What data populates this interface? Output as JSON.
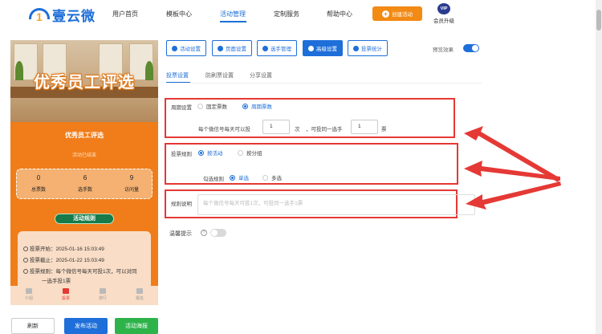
{
  "header": {
    "logo_text": "壹云微",
    "nav": [
      "用户首页",
      "模板中心",
      "活动管理",
      "定制服务",
      "帮助中心"
    ],
    "active_nav": "活动管理",
    "create_button": "创建活动",
    "vip_badge": "VIP",
    "vip_label": "会员升级"
  },
  "preview": {
    "banner_title": "优秀员工评选",
    "title": "优秀员工评选",
    "status": "活动已结束",
    "stats": [
      {
        "value": "0",
        "label": "总票数"
      },
      {
        "value": "6",
        "label": "选手数"
      },
      {
        "value": "9",
        "label": "访问量"
      }
    ],
    "rules_button": "活动规则",
    "info": {
      "start": "投票开始：2025-01-16 15:03:49",
      "end": "投票截止：2025-01-22 15:03:49",
      "rule_line1": "投票规则：每个微信号每天可投1次，可以对同",
      "rule_line2": "一选手投1票"
    },
    "tabbar": [
      "介绍",
      "投票",
      "排行",
      "报名"
    ],
    "active_tab": "投票"
  },
  "footer_buttons": {
    "refresh": "刷新",
    "publish": "发布活动",
    "poster": "活动海报"
  },
  "settings": {
    "tabs": [
      "活动设置",
      "页面设置",
      "选手管理",
      "高级设置",
      "投票统计"
    ],
    "active_tab": "高级设置",
    "preview_label": "预览效果",
    "preview_on": true,
    "inner_tabs": [
      "投票设置",
      "防刷票设置",
      "分享设置"
    ],
    "active_inner_tab": "投票设置",
    "cycle": {
      "label": "周期设置",
      "options": [
        "固定票数",
        "周期票数"
      ],
      "selected": "周期票数",
      "sentence_a": "每个微信号每天可以投",
      "votes_per_day": "1",
      "unit_a": "次",
      "sentence_b": "，可投同一选手",
      "votes_same": "1",
      "unit_b": "票"
    },
    "rule": {
      "label": "投票规则",
      "options": [
        "按活动",
        "按分组"
      ],
      "selected": "按活动",
      "select_label": "勾选规则",
      "select_options": [
        "单选",
        "多选"
      ],
      "select_selected": "单选"
    },
    "desc": {
      "label": "规则说明",
      "placeholder": "每个微信号每天可投1次，可投同一选手1票"
    },
    "tips": {
      "label": "温馨提示",
      "help": "?",
      "enabled": false
    }
  },
  "colors": {
    "primary": "#1e6fd9",
    "accent": "#f28a14",
    "highlight": "#e53935",
    "success": "#2db34a"
  }
}
